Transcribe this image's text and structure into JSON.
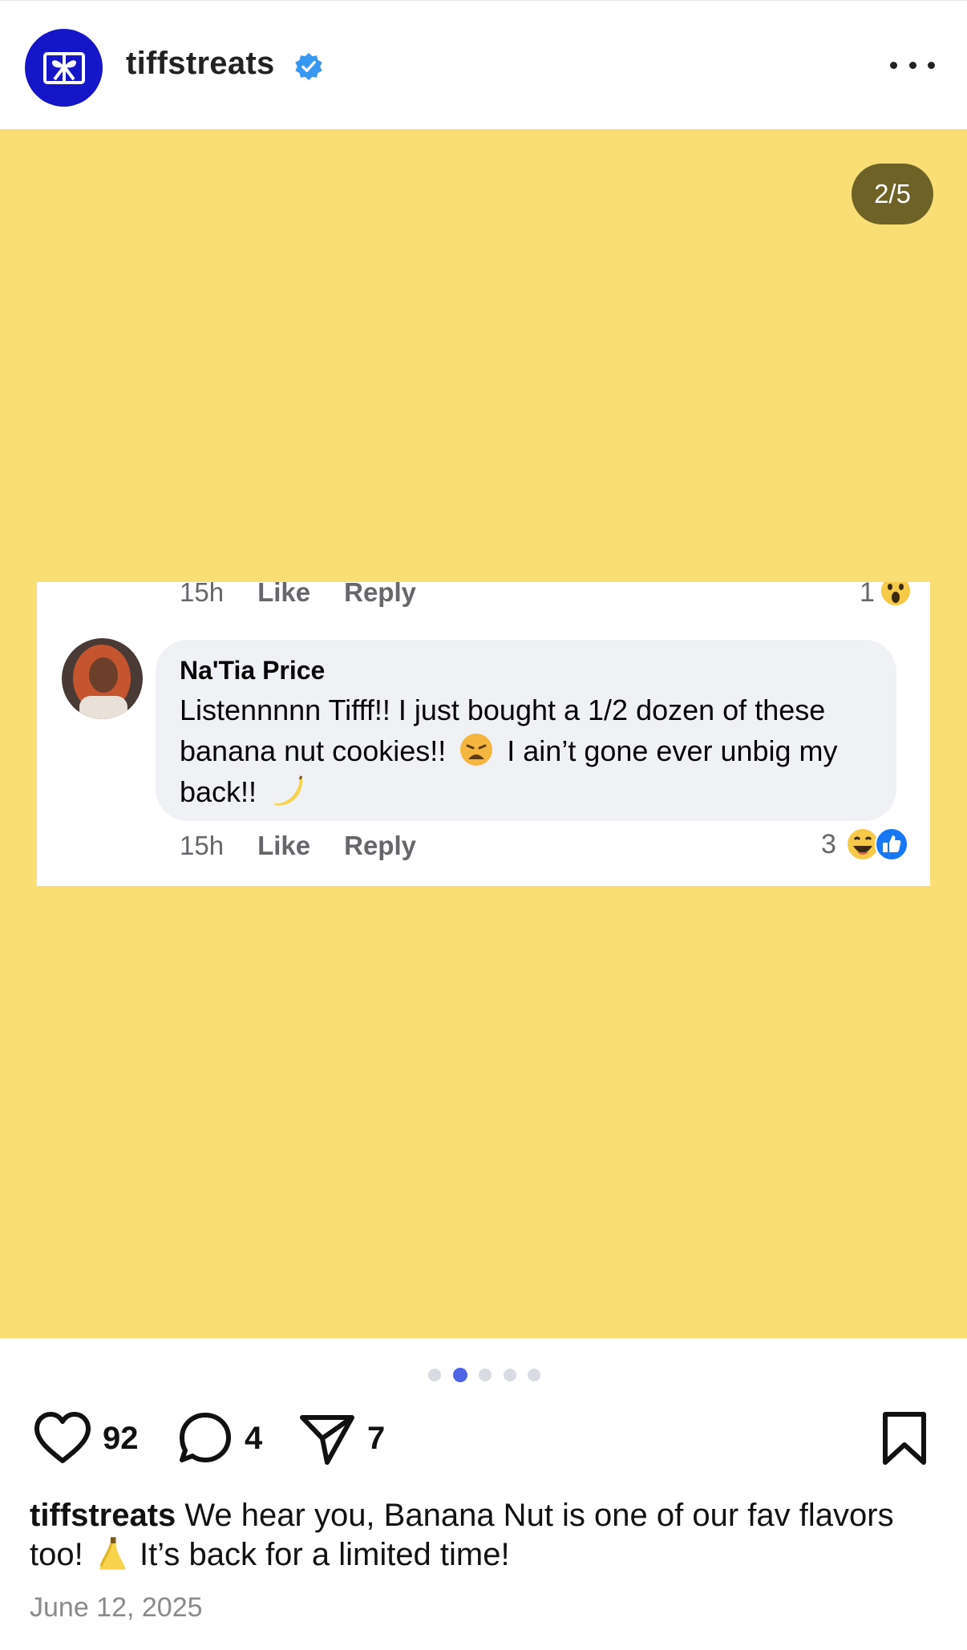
{
  "post_header": {
    "username": "tiffstreats",
    "avatar_icon": "gift-box-icon",
    "verified_icon": "verified-badge-icon",
    "more_icon": "more-options-icon",
    "brand_color": "#1616c9"
  },
  "media": {
    "background_color": "#f8de74",
    "slide_counter": "2/5",
    "comment_card": {
      "prev_reply_row": {
        "time": "15h",
        "like": "Like",
        "reply": "Reply",
        "reaction_count": "1",
        "reaction_icon": "wow-emoji-icon"
      },
      "commenter_name": "Na'Tia Price",
      "comment_text_part1": "Listennnnn Tifff!! I just bought a 1/2 dozen of these banana nut cookies!!",
      "comment_emoji_1": "weary-face-emoji",
      "comment_text_part2": "I ain’t gone ever unbig my back!!",
      "comment_emoji_2": "banana-emoji",
      "reply_row": {
        "time": "15h",
        "like": "Like",
        "reply": "Reply",
        "reaction_count": "3",
        "reaction_icons": [
          "laughing-emoji-icon",
          "like-thumb-icon"
        ]
      }
    }
  },
  "carousel": {
    "total": 5,
    "active_index": 1
  },
  "actions": {
    "likes": "92",
    "comments": "4",
    "shares": "7",
    "icons": [
      "heart-icon",
      "comment-icon",
      "share-icon",
      "bookmark-icon"
    ]
  },
  "caption": {
    "username": "tiffstreats",
    "text_part1": " We hear you, Banana Nut is one of our fav flavors too! ",
    "emoji": "banana-emoji",
    "text_part2": " It’s back for a limited time!"
  },
  "date": "June 12, 2025"
}
